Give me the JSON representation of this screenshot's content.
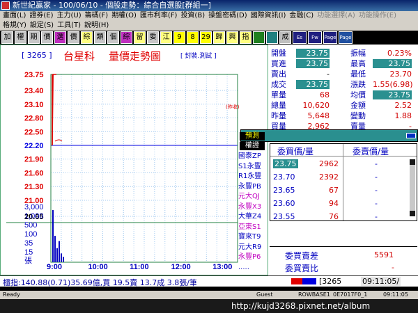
{
  "window": {
    "title": "新世紀贏家 - 100/06/10 - 個股走勢：綜合自選股[群組一]"
  },
  "menu": {
    "row1": [
      "畫面(L)",
      "證券(E)",
      "主力(U)",
      "籌碼(F)",
      "期權(O)",
      "匯市利率(F)",
      "投資(B)",
      "操盤密碼(D)",
      "國際資訊(I)",
      "金融(C)",
      "功能選擇(A)",
      "功能操作(E)"
    ],
    "row2": [
      "格規(Y)",
      "設定(S)",
      "工具(T)",
      "說明(H)"
    ]
  },
  "toolbar": {
    "buttons": [
      "加",
      "權",
      "期",
      "價",
      "選",
      "價",
      "綜",
      "類",
      "個",
      "綜",
      "留",
      "委",
      "江",
      "9",
      "8",
      "29",
      "歸",
      "興",
      "指",
      "",
      "",
      "成",
      "Es",
      "Fw",
      "Page",
      "Page"
    ]
  },
  "chart": {
    "code": "[ 3265 ]",
    "name": "台星科",
    "title": "量價走勢圖",
    "tag": "[ 封裝.測試 ]",
    "price_labels": [
      "23.75",
      "23.40",
      "23.10",
      "22.80",
      "22.50",
      "22.20",
      "21.90",
      "21.60",
      "21.30",
      "21.00",
      "20.65"
    ],
    "ref_price": "22.20",
    "ref_note": "(昨收)",
    "volume_labels": [
      "3,000",
      "1,000",
      "500",
      "100",
      "35",
      "15",
      "張"
    ],
    "time_labels": [
      "9:00",
      "10:00",
      "11:00",
      "12:00",
      "13:00"
    ],
    "accent_price": "#e00000",
    "accent_ref": "#0000e0",
    "accent_vol": "#0000c0"
  },
  "chart_data": {
    "type": "line",
    "title": "量價走勢圖",
    "x": [
      "9:00",
      "9:01",
      "9:02",
      "9:03",
      "9:04",
      "9:05"
    ],
    "series": [
      {
        "name": "",
        "values": [
          22.2,
          23.75,
          23.75,
          23.75,
          23.75,
          23.75
        ]
      }
    ],
    "volume": [
      2962,
      1500,
      800,
      1200,
      500,
      300
    ],
    "ylim": [
      20.65,
      23.75
    ],
    "xlabel": "",
    "ylabel": ""
  },
  "quote": {
    "rows": [
      {
        "l": "開盤",
        "v": "23.75",
        "box": true,
        "l2": "振幅",
        "v2": "0.23%",
        "box2": false
      },
      {
        "l": "買進",
        "v": "23.75",
        "box": true,
        "l2": "最高",
        "v2": "23.75",
        "box2": true
      },
      {
        "l": "賣出",
        "v": "-",
        "box": false,
        "l2": "最低",
        "v2": "23.70",
        "box2": false
      },
      {
        "l": "成交",
        "v": "23.75",
        "box": true,
        "l2": "漲跌",
        "v2": "1.55(6.98)",
        "box2": false
      },
      {
        "l": "單量",
        "v": "68",
        "box": false,
        "l2": "均價",
        "v2": "23.75",
        "box2": true
      },
      {
        "l": "總量",
        "v": "10,620",
        "box": false,
        "l2": "金額",
        "v2": "2.52",
        "box2": false
      },
      {
        "l": "昨量",
        "v": "5,648",
        "box": false,
        "l2": "變動",
        "v2": "1.88",
        "box2": false
      },
      {
        "l": "買量",
        "v": "2,962",
        "box": false,
        "l2": "賣量",
        "v2": "-",
        "box2": false
      }
    ],
    "predict_label": "預測",
    "broker_label": "權證",
    "brokers": [
      "國泰ZP",
      "S1永豐",
      "R1永豐",
      "永豐PB",
      "元大QJ",
      "永豐X3",
      "大華Z4",
      "亞東S1",
      "寶來T9",
      "元大R9",
      "永豐P6",
      "....."
    ],
    "bid_header": "委買價/量",
    "ask_header": "委賣價/量",
    "bids": [
      {
        "p": "23.75",
        "q": "2962"
      },
      {
        "p": "23.70",
        "q": "2392"
      },
      {
        "p": "23.65",
        "q": "67"
      },
      {
        "p": "23.60",
        "q": "94"
      },
      {
        "p": "23.55",
        "q": "76"
      }
    ],
    "asks": [
      "-",
      "-",
      "-",
      "-",
      "-"
    ],
    "diff_label": "委買賣差",
    "diff_value": "5591",
    "ratio_label": "委買賣比",
    "ratio_value": "-"
  },
  "ticker": {
    "text": "櫃指:140.88(0.71)35.69億,買 19.5賣 13.7成 3.8張/筆",
    "code": "[3265",
    "time": "09:11:05/"
  },
  "status": {
    "ready": "Ready",
    "guest": "Guest",
    "s1": "ROWBASE1",
    "s2": "0E7017F0_1",
    "s3": "09:11:05"
  },
  "footer": {
    "url": "http://kujd3268.pixnet.net/album"
  }
}
